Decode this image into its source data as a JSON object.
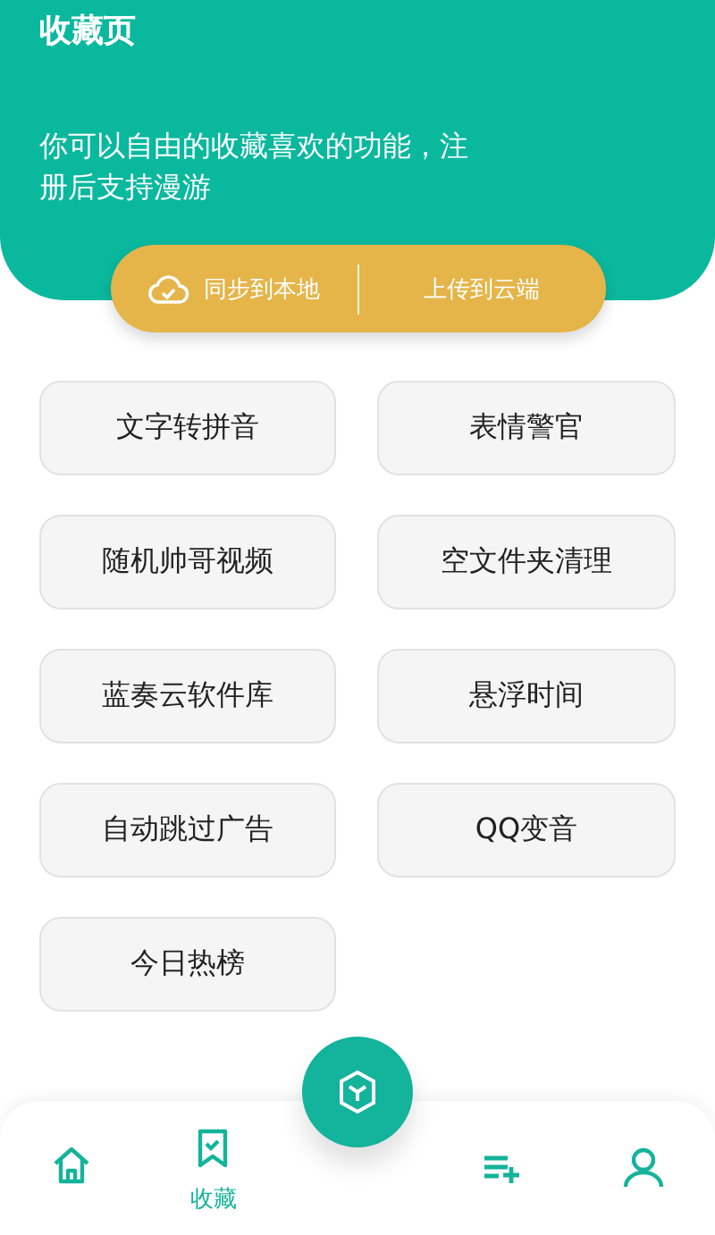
{
  "header": {
    "title": "收藏页",
    "description": "你可以自由的收藏喜欢的功能，注册后支持漫游"
  },
  "sync_bar": {
    "download": "同步到本地",
    "upload": "上传到云端"
  },
  "favorites": [
    "文字转拼音",
    "表情警官",
    "随机帅哥视频",
    "空文件夹清理",
    "蓝奏云软件库",
    "悬浮时间",
    "自动跳过广告",
    "QQ变音",
    "今日热榜"
  ],
  "nav": [
    {
      "kind": "home",
      "selected": false
    },
    {
      "kind": "favorites",
      "label": "收藏",
      "selected": true
    },
    {
      "kind": "center",
      "selected": false
    },
    {
      "kind": "playlist",
      "selected": false
    },
    {
      "kind": "profile",
      "selected": false
    }
  ]
}
